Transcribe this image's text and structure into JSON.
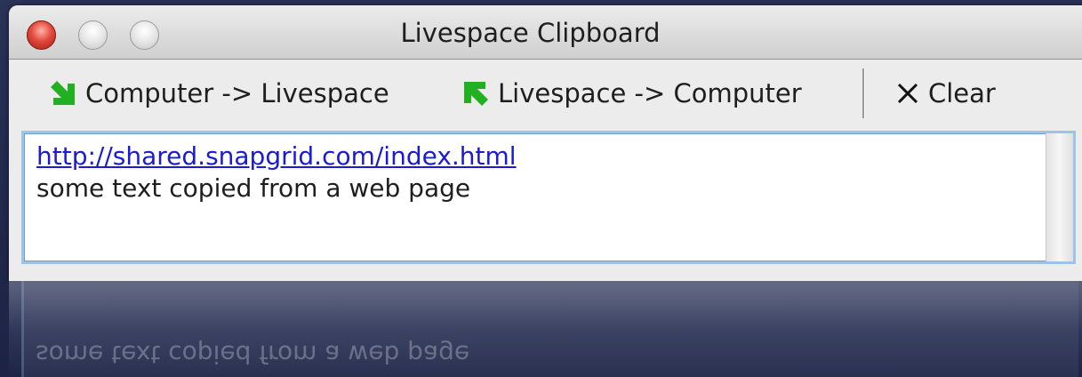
{
  "window": {
    "title": "Livespace Clipboard"
  },
  "toolbar": {
    "computer_to_livespace_label": "Computer -> Livespace",
    "livespace_to_computer_label": "Livespace -> Computer",
    "clear_label": "Clear"
  },
  "clipboard": {
    "link": "http://shared.snapgrid.com/index.html",
    "text": "some text copied from a web page"
  },
  "icons": {
    "arrow_down_right": "arrow-down-right-icon",
    "arrow_up_left": "arrow-up-left-icon",
    "close_x": "clear-x-icon"
  },
  "colors": {
    "arrow_green": "#22b022",
    "link_blue": "#1b1bd6",
    "close_red": "#e34a3c",
    "focus_ring": "#9cc3e8"
  }
}
